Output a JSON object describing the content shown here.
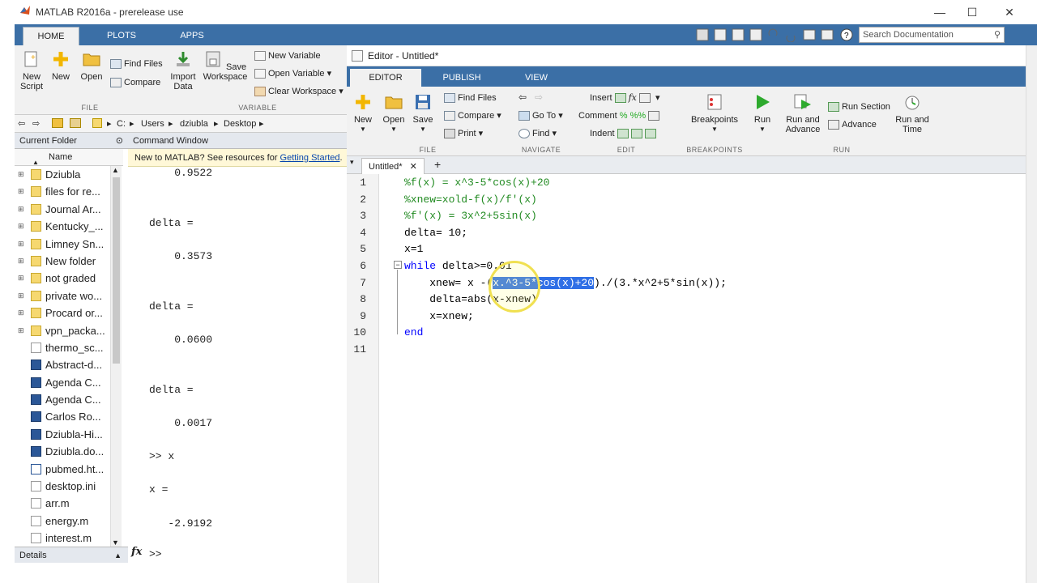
{
  "window": {
    "title": "MATLAB R2016a - prerelease use",
    "min": "—",
    "max": "☐",
    "close": "✕"
  },
  "main_tabs": [
    "HOME",
    "PLOTS",
    "APPS"
  ],
  "search": {
    "placeholder": "Search Documentation"
  },
  "home_ribbon": {
    "new_script": "New\nScript",
    "new": "New",
    "open": "Open",
    "find_files": "Find Files",
    "compare": "Compare",
    "import_data": "Import\nData",
    "save_workspace": "Save\nWorkspace",
    "new_variable": "New Variable",
    "open_variable": "Open Variable",
    "clear_workspace": "Clear Workspace",
    "file_label": "FILE",
    "variable_label": "VARIABLE"
  },
  "address": {
    "parts": [
      "C:",
      "Users",
      "dziubla",
      "Desktop"
    ]
  },
  "current_folder": {
    "title": "Current Folder",
    "col_name": "Name",
    "items": [
      {
        "name": "Dziubla",
        "kind": "folder"
      },
      {
        "name": "files for re...",
        "kind": "folder"
      },
      {
        "name": "Journal Ar...",
        "kind": "folder"
      },
      {
        "name": "Kentucky_...",
        "kind": "folder"
      },
      {
        "name": "Limney Sn...",
        "kind": "folder"
      },
      {
        "name": "New folder",
        "kind": "folder"
      },
      {
        "name": "not graded",
        "kind": "folder"
      },
      {
        "name": "private wo...",
        "kind": "folder"
      },
      {
        "name": "Procard or...",
        "kind": "folder"
      },
      {
        "name": "vpn_packa...",
        "kind": "folder"
      },
      {
        "name": "thermo_sc...",
        "kind": "file"
      },
      {
        "name": "Abstract-d...",
        "kind": "doc"
      },
      {
        "name": "Agenda C...",
        "kind": "doc"
      },
      {
        "name": "Agenda C...",
        "kind": "doc"
      },
      {
        "name": "Carlos Ro...",
        "kind": "doc"
      },
      {
        "name": "Dziubla-Hi...",
        "kind": "doc"
      },
      {
        "name": "Dziubla.do...",
        "kind": "doc"
      },
      {
        "name": "pubmed.ht...",
        "kind": "html"
      },
      {
        "name": "desktop.ini",
        "kind": "file"
      },
      {
        "name": "arr.m",
        "kind": "m"
      },
      {
        "name": "energy.m",
        "kind": "m"
      },
      {
        "name": "interest.m",
        "kind": "m"
      }
    ],
    "details": "Details"
  },
  "command_window": {
    "title": "Command Window",
    "banner_text": "New to MATLAB? See resources for ",
    "banner_link": "Getting Started",
    "banner_end": ".",
    "lines": [
      {
        "text": "    0.9522"
      },
      {
        "text": ""
      },
      {
        "text": ""
      },
      {
        "text": "delta ="
      },
      {
        "text": ""
      },
      {
        "text": "    0.3573"
      },
      {
        "text": ""
      },
      {
        "text": ""
      },
      {
        "text": "delta ="
      },
      {
        "text": ""
      },
      {
        "text": "    0.0600"
      },
      {
        "text": ""
      },
      {
        "text": ""
      },
      {
        "text": "delta ="
      },
      {
        "text": ""
      },
      {
        "text": "    0.0017"
      },
      {
        "text": ""
      },
      {
        "text": ">> x"
      },
      {
        "text": ""
      },
      {
        "text": "x ="
      },
      {
        "text": ""
      },
      {
        "text": "   -2.9192"
      }
    ],
    "prompt": ">>"
  },
  "editor": {
    "title": "Editor - Untitled*",
    "tabs": [
      "EDITOR",
      "PUBLISH",
      "VIEW"
    ],
    "doc_tab": "Untitled*",
    "ribbon": {
      "new": "New",
      "open": "Open",
      "save": "Save",
      "find_files": "Find Files",
      "compare": "Compare",
      "print": "Print",
      "go_to": "Go To",
      "find": "Find",
      "insert": "Insert",
      "comment": "Comment",
      "indent": "Indent",
      "breakpoints": "Breakpoints",
      "run": "Run",
      "run_and_advance": "Run and\nAdvance",
      "run_section": "Run Section",
      "advance": "Advance",
      "run_and_time": "Run and\nTime",
      "labels": [
        "FILE",
        "NAVIGATE",
        "EDIT",
        "BREAKPOINTS",
        "RUN"
      ]
    },
    "code_lines": [
      {
        "n": "1",
        "a": "",
        "c": "%f(x) = x^3-5*cos(x)+20"
      },
      {
        "n": "2",
        "a": "",
        "c": "%xnew=xold-f(x)/f'(x)"
      },
      {
        "n": "3",
        "a": "",
        "c": "%f'(x) = 3x^2+5sin(x)"
      },
      {
        "n": "4",
        "a": "delta= 10;"
      },
      {
        "n": "5",
        "a": "x=1"
      },
      {
        "n": "6",
        "k": "while",
        "a": " delta>=0.01"
      },
      {
        "n": "7",
        "a": "    xnew= x -(",
        "s": "x.^3-5*cos(x)+20",
        "b": ")./(3.*x^2+5*sin(x));"
      },
      {
        "n": "8",
        "a": "    delta=abs(x-xnew)"
      },
      {
        "n": "9",
        "a": "    x=xnew;"
      },
      {
        "n": "10",
        "k": "end",
        "a": ""
      },
      {
        "n": "11",
        "a": ""
      }
    ]
  },
  "colors": {
    "ribbon_blue": "#3b6fa6",
    "comment_green": "#228b22",
    "keyword_blue": "#0000ff",
    "selection": "#2f6fe6"
  }
}
